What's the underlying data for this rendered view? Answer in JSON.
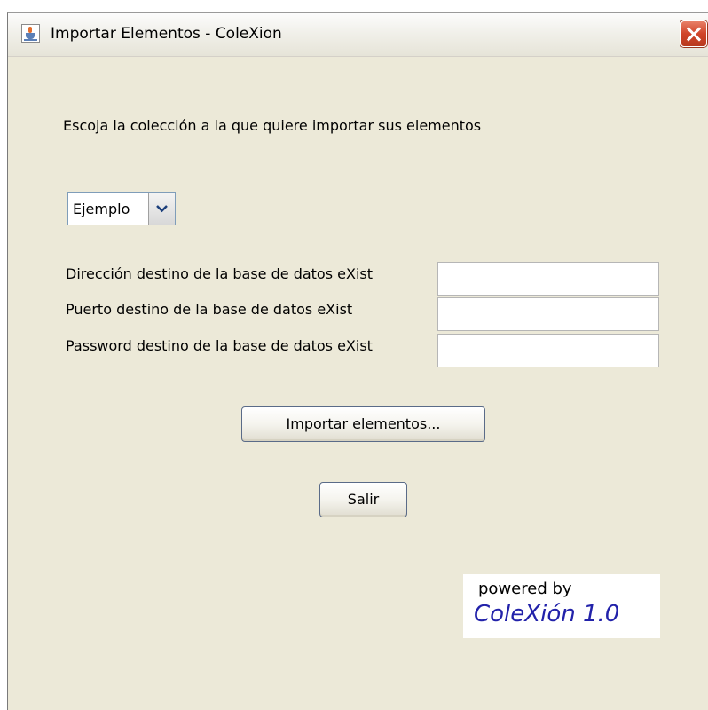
{
  "window": {
    "title": "Importar Elementos - ColeXion",
    "app_icon": "java-cup-icon",
    "close_icon": "close-icon"
  },
  "form": {
    "instruction": "Escoja la colección a la que quiere importar sus elementos",
    "collection_select": {
      "selected": "Ejemplo",
      "icon": "chevron-down-icon"
    },
    "fields": [
      {
        "label": "Dirección destino de la base de datos eXist",
        "value": ""
      },
      {
        "label": "Puerto destino de la base de datos eXist",
        "value": ""
      },
      {
        "label": "Password destino de la base de datos eXist",
        "value": ""
      }
    ],
    "import_button": "Importar elementos...",
    "exit_button": "Salir"
  },
  "branding": {
    "powered_by": "powered by",
    "product": "ColeXión 1.0",
    "accent_color": "#2222aa"
  }
}
